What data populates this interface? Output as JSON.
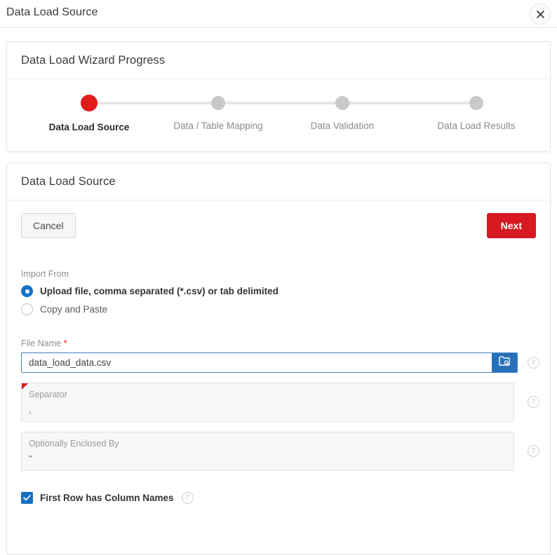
{
  "dialog": {
    "title": "Data Load Source",
    "close_icon": "close-icon"
  },
  "progress_panel": {
    "title": "Data Load Wizard Progress",
    "current_index": 0,
    "steps": [
      {
        "label": "Data Load Source",
        "state": "current"
      },
      {
        "label": "Data / Table Mapping",
        "state": "pending"
      },
      {
        "label": "Data Validation",
        "state": "pending"
      },
      {
        "label": "Data Load Results",
        "state": "pending"
      }
    ],
    "colors": {
      "current_dot": "#e21b1b",
      "pending_dot": "#c9c9c9",
      "track": "#e4e4e4"
    }
  },
  "form_panel": {
    "title": "Data Load Source",
    "buttons": {
      "cancel_label": "Cancel",
      "next_label": "Next",
      "next_color": "#d81921"
    },
    "import_from": {
      "group_label": "Import From",
      "options": [
        {
          "label": "Upload file, comma separated (*.csv) or tab delimited",
          "selected": true
        },
        {
          "label": "Copy and Paste",
          "selected": false
        }
      ]
    },
    "file_name": {
      "label": "File Name",
      "required_marker": "*",
      "value": "data_load_data.csv",
      "browse_icon": "folder-search-icon",
      "help_icon": "?"
    },
    "separator": {
      "placeholder": "Separator",
      "value": ",",
      "flagged": true,
      "help_icon": "?"
    },
    "enclosed_by": {
      "placeholder": "Optionally Enclosed By",
      "value": "\"",
      "flagged": false,
      "help_icon": "?"
    },
    "first_row": {
      "label": "First Row has Column Names",
      "checked": true,
      "help_icon": "?"
    }
  }
}
